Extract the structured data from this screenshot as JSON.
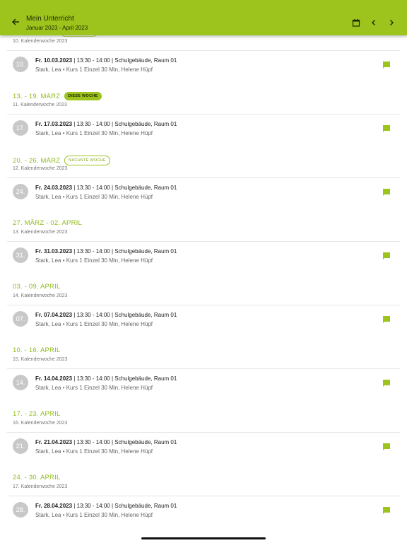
{
  "appbar": {
    "title": "Mein Unterricht",
    "subtitle": "Januar 2023 - April 2023",
    "back_icon": "arrow-back-icon",
    "calendar_icon": "calendar-icon",
    "prev_icon": "chevron-left-icon",
    "next_icon": "chevron-right-icon",
    "color": "#9dc31d"
  },
  "weeks": [
    {
      "title": "",
      "subtitle": "10. Kalenderwoche 2023",
      "badge": "",
      "entry": {
        "day": "10.",
        "date": "Fr. 10.03.2023",
        "details": " | 13:30 - 14:00 | Schulgebäude, Raum 01",
        "line2": "Stark, Lea • Kurs 1 Einzel 30 Min, Helene Hüpf"
      }
    },
    {
      "title": "13. - 19. MÄRZ",
      "subtitle": "11. Kalenderwoche 2023",
      "badge": "DIESE WOCHE",
      "entry": {
        "day": "17.",
        "date": "Fr. 17.03.2023",
        "details": " | 13:30 - 14:00 | Schulgebäude, Raum 01",
        "line2": "Stark, Lea • Kurs 1 Einzel 30 Min, Helene Hüpf"
      }
    },
    {
      "title": "20. - 26. MÄRZ",
      "subtitle": "12. Kalenderwoche 2023",
      "badge": "NÄCHSTE WOCHE",
      "entry": {
        "day": "24.",
        "date": "Fr. 24.03.2023",
        "details": " | 13:30 - 14:00 | Schulgebäude, Raum 01",
        "line2": "Stark, Lea • Kurs 1 Einzel 30 Min, Helene Hüpf"
      }
    },
    {
      "title": "27. MÄRZ - 02. APRIL",
      "subtitle": "13. Kalenderwoche 2023",
      "badge": "",
      "entry": {
        "day": "31.",
        "date": "Fr. 31.03.2023",
        "details": " | 13:30 - 14:00 | Schulgebäude, Raum 01",
        "line2": "Stark, Lea • Kurs 1 Einzel 30 Min, Helene Hüpf"
      }
    },
    {
      "title": "03. - 09. APRIL",
      "subtitle": "14. Kalenderwoche 2023",
      "badge": "",
      "entry": {
        "day": "07.",
        "date": "Fr. 07.04.2023",
        "details": " | 13:30 - 14:00 | Schulgebäude, Raum 01",
        "line2": "Stark, Lea • Kurs 1 Einzel 30 Min, Helene Hüpf"
      }
    },
    {
      "title": "10. - 16. APRIL",
      "subtitle": "15. Kalenderwoche 2023",
      "badge": "",
      "entry": {
        "day": "14.",
        "date": "Fr. 14.04.2023",
        "details": " | 13:30 - 14:00 | Schulgebäude, Raum 01",
        "line2": "Stark, Lea • Kurs 1 Einzel 30 Min, Helene Hüpf"
      }
    },
    {
      "title": "17. - 23. APRIL",
      "subtitle": "16. Kalenderwoche 2023",
      "badge": "",
      "entry": {
        "day": "21.",
        "date": "Fr. 21.04.2023",
        "details": " | 13:30 - 14:00 | Schulgebäude, Raum 01",
        "line2": "Stark, Lea • Kurs 1 Einzel 30 Min, Helene Hüpf"
      }
    },
    {
      "title": "24. - 30. APRIL",
      "subtitle": "17. Kalenderwoche 2023",
      "badge": "",
      "entry": {
        "day": "28.",
        "date": "Fr. 28.04.2023",
        "details": " | 13:30 - 14:00 | Schulgebäude, Raum 01",
        "line2": "Stark, Lea • Kurs 1 Einzel 30 Min, Helene Hüpf"
      }
    }
  ],
  "comment_icon": "comment-icon",
  "accent": "#9dc31d"
}
